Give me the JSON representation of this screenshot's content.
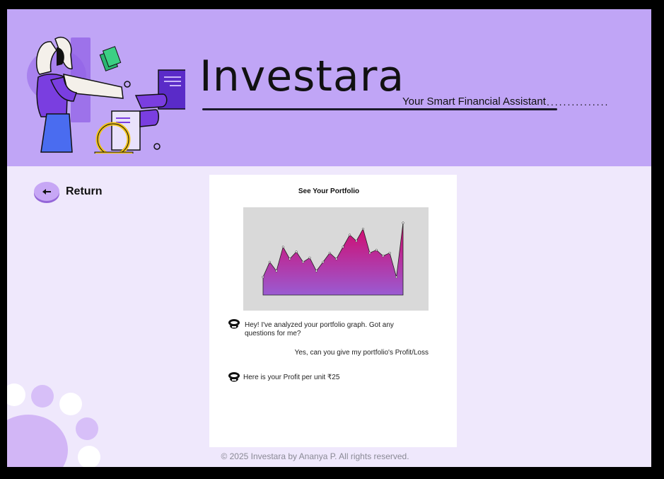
{
  "header": {
    "title": "Investara",
    "tagline": "Your Smart Financial Assistant",
    "tagline_dots": "..............."
  },
  "nav": {
    "return_label": "Return"
  },
  "portfolio": {
    "title": "See Your Portfolio",
    "chart_data": {
      "type": "area",
      "x": [
        1,
        2,
        3,
        4,
        5,
        6,
        7,
        8,
        9,
        10,
        11,
        12,
        13,
        14,
        15,
        16,
        17,
        18,
        19,
        20,
        21,
        22
      ],
      "values": [
        30,
        55,
        40,
        80,
        60,
        72,
        55,
        62,
        40,
        55,
        70,
        60,
        80,
        100,
        90,
        110,
        70,
        75,
        65,
        70,
        30,
        120
      ],
      "fill_top_color": "#d4076a",
      "fill_bottom_color": "#9a5bd2",
      "title": "",
      "xlabel": "",
      "ylabel": ""
    }
  },
  "chat": {
    "bot_message_1": "Hey! I've analyzed your portfolio graph. Got any questions for me?",
    "user_message": "Yes, can you give my portfolio's Profit/Loss",
    "bot_message_2": "Here is your Profit per unit ₹25"
  },
  "footer": {
    "text": "© 2025 Investara by Ananya P. All rights reserved."
  },
  "colors": {
    "header_bg": "#c0a5f6",
    "page_bg": "#efe8fc",
    "accent": "#6a2bd8"
  }
}
